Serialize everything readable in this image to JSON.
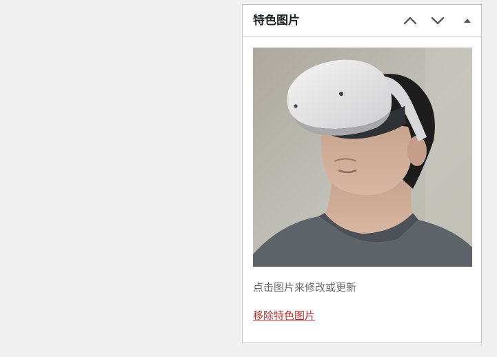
{
  "metabox": {
    "title": "特色图片",
    "move_up_icon": "chevron-up-icon",
    "move_down_icon": "chevron-down-icon",
    "toggle_icon": "triangle-up-icon",
    "image": {
      "description": "featured-image-thumbnail"
    },
    "howto_text": "点击图片来修改或更新",
    "remove_link": "移除特色图片"
  },
  "colors": {
    "background": "#f0f0f1",
    "box_border": "#c3c4c7",
    "title": "#1d2327",
    "icon": "#50575e",
    "howto": "#646970",
    "remove_link": "#b32d2e"
  }
}
